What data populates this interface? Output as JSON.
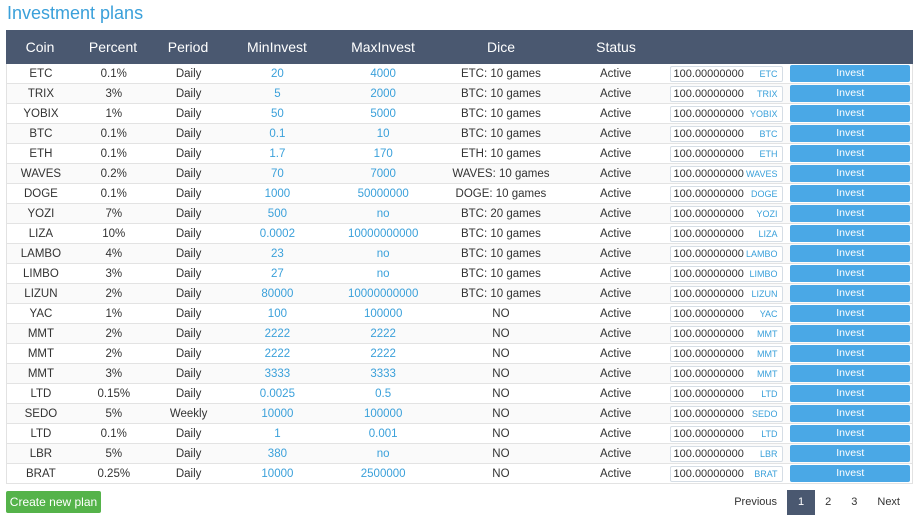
{
  "title": "Investment plans",
  "headers": {
    "coin": "Coin",
    "percent": "Percent",
    "period": "Period",
    "mininvest": "MinInvest",
    "maxinvest": "MaxInvest",
    "dice": "Dice",
    "status": "Status"
  },
  "amount_value": "100.00000000",
  "invest_label": "Invest",
  "rows": [
    {
      "coin": "ETC",
      "percent": "0.1%",
      "period": "Daily",
      "min": "20",
      "max": "4000",
      "dice": "ETC: 10 games",
      "status": "Active"
    },
    {
      "coin": "TRIX",
      "percent": "3%",
      "period": "Daily",
      "min": "5",
      "max": "2000",
      "dice": "BTC: 10 games",
      "status": "Active"
    },
    {
      "coin": "YOBIX",
      "percent": "1%",
      "period": "Daily",
      "min": "50",
      "max": "5000",
      "dice": "BTC: 10 games",
      "status": "Active"
    },
    {
      "coin": "BTC",
      "percent": "0.1%",
      "period": "Daily",
      "min": "0.1",
      "max": "10",
      "dice": "BTC: 10 games",
      "status": "Active"
    },
    {
      "coin": "ETH",
      "percent": "0.1%",
      "period": "Daily",
      "min": "1.7",
      "max": "170",
      "dice": "ETH: 10 games",
      "status": "Active"
    },
    {
      "coin": "WAVES",
      "percent": "0.2%",
      "period": "Daily",
      "min": "70",
      "max": "7000",
      "dice": "WAVES: 10 games",
      "status": "Active"
    },
    {
      "coin": "DOGE",
      "percent": "0.1%",
      "period": "Daily",
      "min": "1000",
      "max": "50000000",
      "dice": "DOGE: 10 games",
      "status": "Active"
    },
    {
      "coin": "YOZI",
      "percent": "7%",
      "period": "Daily",
      "min": "500",
      "max": "no",
      "dice": "BTC: 20 games",
      "status": "Active"
    },
    {
      "coin": "LIZA",
      "percent": "10%",
      "period": "Daily",
      "min": "0.0002",
      "max": "10000000000",
      "dice": "BTC: 10 games",
      "status": "Active"
    },
    {
      "coin": "LAMBO",
      "percent": "4%",
      "period": "Daily",
      "min": "23",
      "max": "no",
      "dice": "BTC: 10 games",
      "status": "Active"
    },
    {
      "coin": "LIMBO",
      "percent": "3%",
      "period": "Daily",
      "min": "27",
      "max": "no",
      "dice": "BTC: 10 games",
      "status": "Active"
    },
    {
      "coin": "LIZUN",
      "percent": "2%",
      "period": "Daily",
      "min": "80000",
      "max": "10000000000",
      "dice": "BTC: 10 games",
      "status": "Active"
    },
    {
      "coin": "YAC",
      "percent": "1%",
      "period": "Daily",
      "min": "100",
      "max": "100000",
      "dice": "NO",
      "status": "Active"
    },
    {
      "coin": "MMT",
      "percent": "2%",
      "period": "Daily",
      "min": "2222",
      "max": "2222",
      "dice": "NO",
      "status": "Active"
    },
    {
      "coin": "MMT",
      "percent": "2%",
      "period": "Daily",
      "min": "2222",
      "max": "2222",
      "dice": "NO",
      "status": "Active"
    },
    {
      "coin": "MMT",
      "percent": "3%",
      "period": "Daily",
      "min": "3333",
      "max": "3333",
      "dice": "NO",
      "status": "Active"
    },
    {
      "coin": "LTD",
      "percent": "0.15%",
      "period": "Daily",
      "min": "0.0025",
      "max": "0.5",
      "dice": "NO",
      "status": "Active"
    },
    {
      "coin": "SEDO",
      "percent": "5%",
      "period": "Weekly",
      "min": "10000",
      "max": "100000",
      "dice": "NO",
      "status": "Active"
    },
    {
      "coin": "LTD",
      "percent": "0.1%",
      "period": "Daily",
      "min": "1",
      "max": "0.001",
      "dice": "NO",
      "status": "Active"
    },
    {
      "coin": "LBR",
      "percent": "5%",
      "period": "Daily",
      "min": "380",
      "max": "no",
      "dice": "NO",
      "status": "Active"
    },
    {
      "coin": "BRAT",
      "percent": "0.25%",
      "period": "Daily",
      "min": "10000",
      "max": "2500000",
      "dice": "NO",
      "status": "Active"
    }
  ],
  "create_button": "Create new plan",
  "pagination": {
    "previous": "Previous",
    "pages": [
      "1",
      "2",
      "3"
    ],
    "current_page": "1",
    "next": "Next"
  },
  "colors": {
    "title": "#3aa0da",
    "header_bg": "#4a5870",
    "link": "#3aa0da",
    "invest_button": "#4aa8e6",
    "create_button": "#55b34a"
  }
}
